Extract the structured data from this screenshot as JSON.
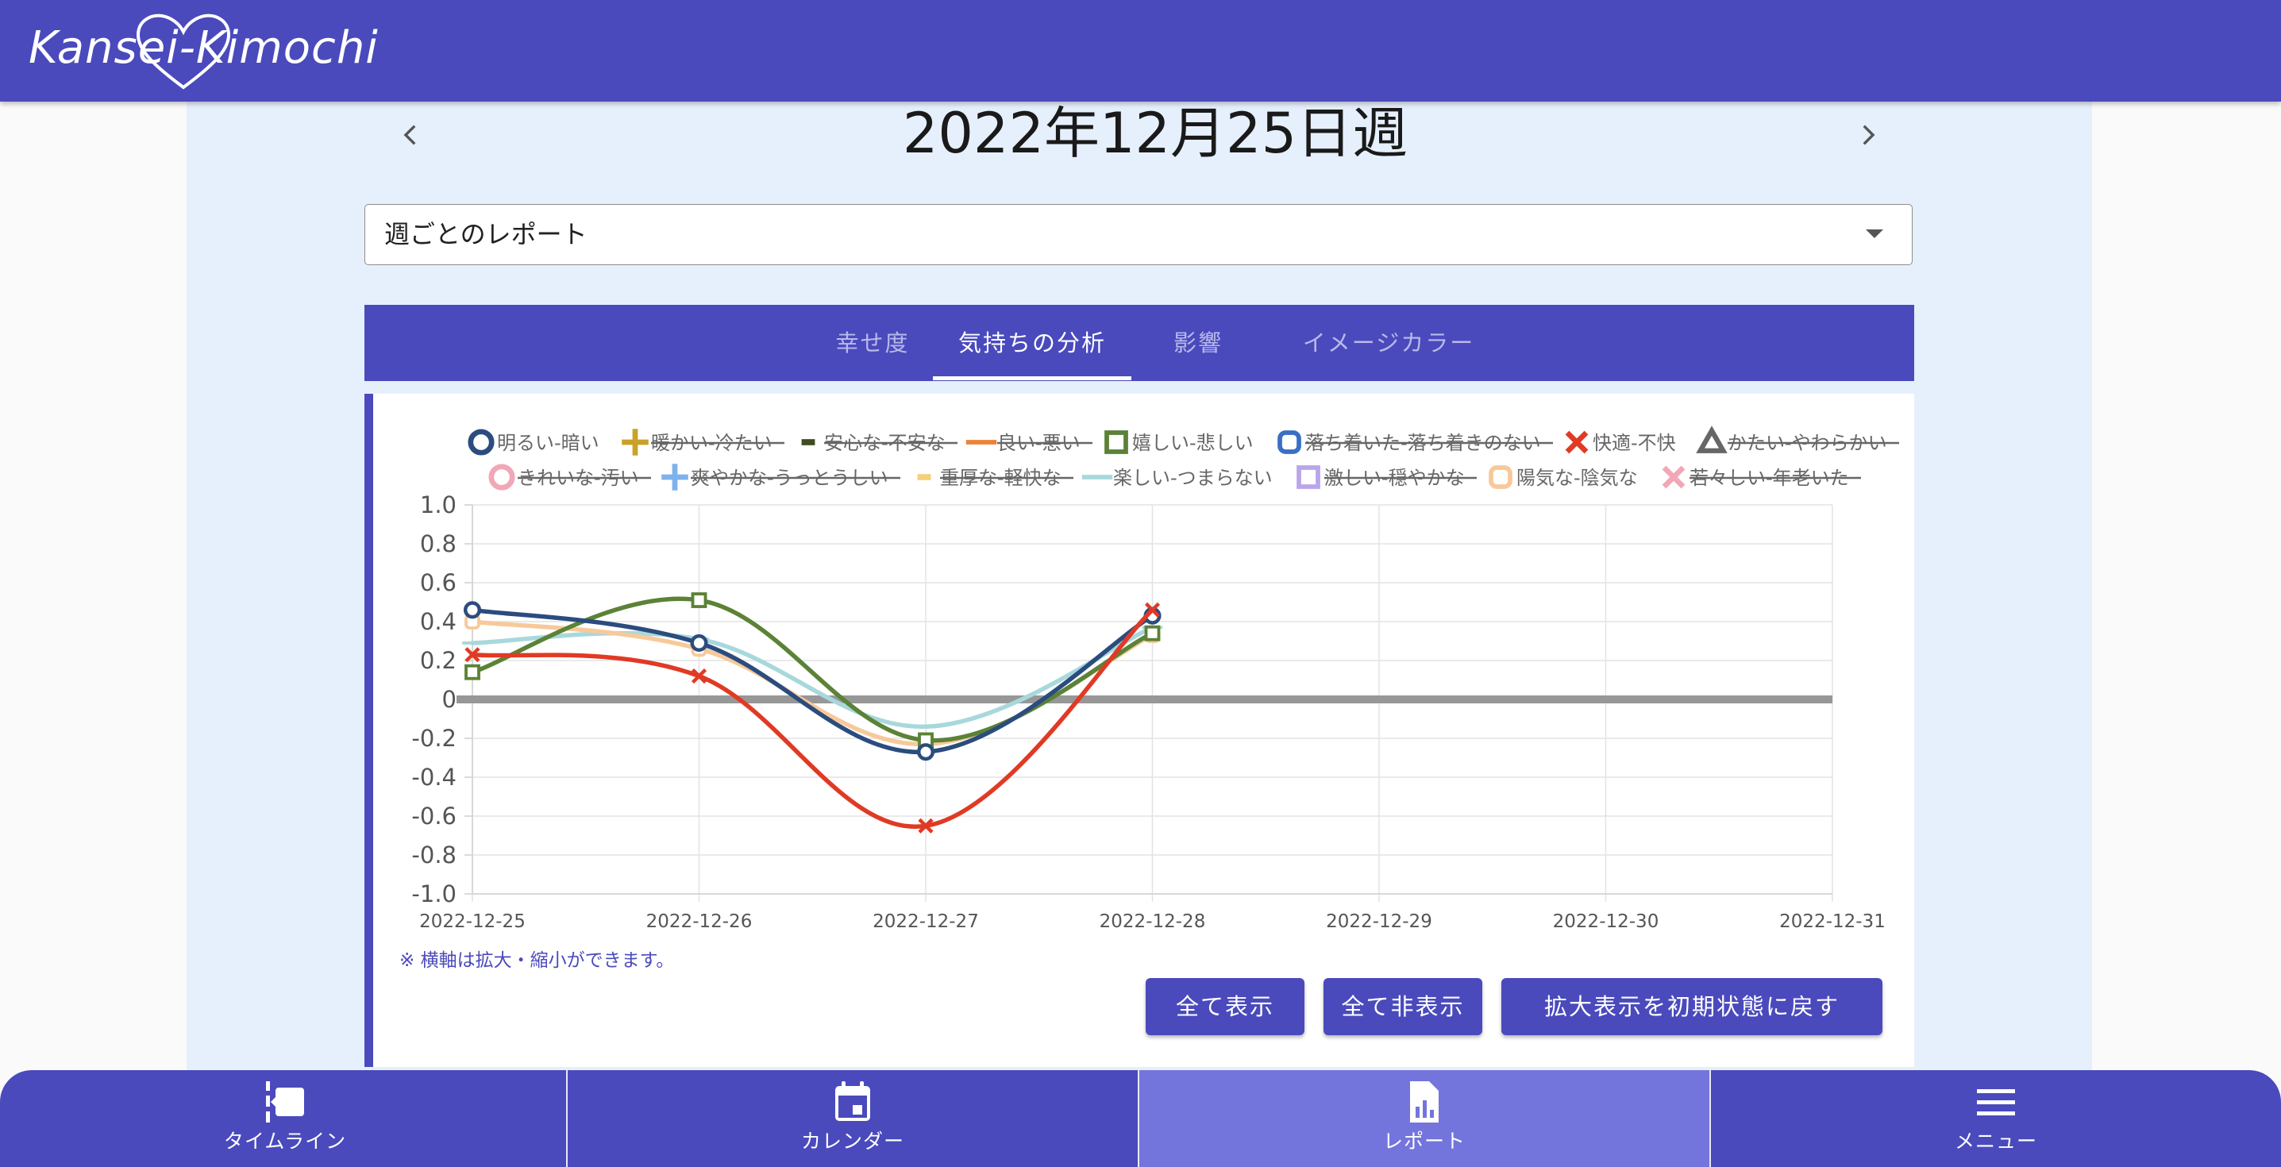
{
  "app": {
    "logo_text": "Kansei-Kimochi",
    "brand_color": "#4a4abd"
  },
  "header": {
    "week_title": "2022年12月25日週",
    "prev_icon": "chevron-left-icon",
    "next_icon": "chevron-right-icon"
  },
  "report_select": {
    "value": "週ごとのレポート"
  },
  "tabs": [
    {
      "label": "幸せ度",
      "active": false
    },
    {
      "label": "気持ちの分析",
      "active": true
    },
    {
      "label": "影響",
      "active": false
    },
    {
      "label": "イメージカラー",
      "active": false
    }
  ],
  "chart_data": {
    "type": "line",
    "x": [
      "2022-12-25",
      "2022-12-26",
      "2022-12-27",
      "2022-12-28",
      "2022-12-29",
      "2022-12-30",
      "2022-12-31"
    ],
    "ylim": [
      -1.0,
      1.0
    ],
    "yticks": [
      "1.0",
      "0.8",
      "0.6",
      "0.4",
      "0.2",
      "0",
      "-0.2",
      "-0.4",
      "-0.6",
      "-0.8",
      "-1.0"
    ],
    "grid": true,
    "zero_line": true,
    "legend_position": "top",
    "series": [
      {
        "name": "明るい-暗い",
        "color": "#2b4c7e",
        "marker": "circle",
        "visible": true,
        "values": [
          0.46,
          0.29,
          -0.27,
          0.43
        ]
      },
      {
        "name": "暖かい-冷たい",
        "color": "#c9a227",
        "marker": "plus",
        "visible": false,
        "values": []
      },
      {
        "name": "安心な-不安な",
        "color": "#3d4d1f",
        "marker": "dash",
        "visible": false,
        "values": []
      },
      {
        "name": "良い-悪い",
        "color": "#e8833a",
        "marker": "line",
        "visible": false,
        "values": []
      },
      {
        "name": "嬉しい-悲しい",
        "color": "#5b8236",
        "marker": "square",
        "visible": true,
        "values": [
          0.14,
          0.51,
          -0.21,
          0.34
        ]
      },
      {
        "name": "落ち着いた-落ち着きのない",
        "color": "#3a6fc4",
        "marker": "rounded-square",
        "visible": false,
        "values": []
      },
      {
        "name": "快適-不快",
        "color": "#e03a25",
        "marker": "cross",
        "visible": true,
        "values": [
          0.23,
          0.12,
          -0.65,
          0.46
        ]
      },
      {
        "name": "かたい-やわらかい",
        "color": "#666666",
        "marker": "triangle",
        "visible": false,
        "values": []
      },
      {
        "name": "きれいな-汚い",
        "color": "#f2a7b6",
        "marker": "circle",
        "visible": false,
        "values": []
      },
      {
        "name": "爽やかな-うっとうしい",
        "color": "#7fb2ec",
        "marker": "plus",
        "visible": false,
        "values": []
      },
      {
        "name": "重厚な-軽快な",
        "color": "#f5d07a",
        "marker": "dash",
        "visible": false,
        "values": []
      },
      {
        "name": "楽しい-つまらない",
        "color": "#a8d8dc",
        "marker": "line",
        "visible": true,
        "values": [
          0.29,
          0.31,
          -0.14,
          0.37
        ]
      },
      {
        "name": "激しい-穏やかな",
        "color": "#b9a6ea",
        "marker": "square",
        "visible": false,
        "values": []
      },
      {
        "name": "陽気な-陰気な",
        "color": "#f7c99a",
        "marker": "rounded-square",
        "visible": true,
        "values": [
          0.4,
          0.26,
          -0.23,
          0.33
        ]
      },
      {
        "name": "若々しい-年老いた",
        "color": "#f2a7b6",
        "marker": "cross",
        "visible": false,
        "values": []
      }
    ]
  },
  "chart_note": "※ 横軸は拡大・縮小ができます。",
  "buttons": {
    "show_all": "全て表示",
    "hide_all": "全て非表示",
    "reset_zoom": "拡大表示を初期状態に戻す"
  },
  "bottom_nav": [
    {
      "label": "タイムライン",
      "icon": "timeline-icon",
      "active": false
    },
    {
      "label": "カレンダー",
      "icon": "calendar-icon",
      "active": false
    },
    {
      "label": "レポート",
      "icon": "report-icon",
      "active": true
    },
    {
      "label": "メニュー",
      "icon": "menu-icon",
      "active": false
    }
  ]
}
